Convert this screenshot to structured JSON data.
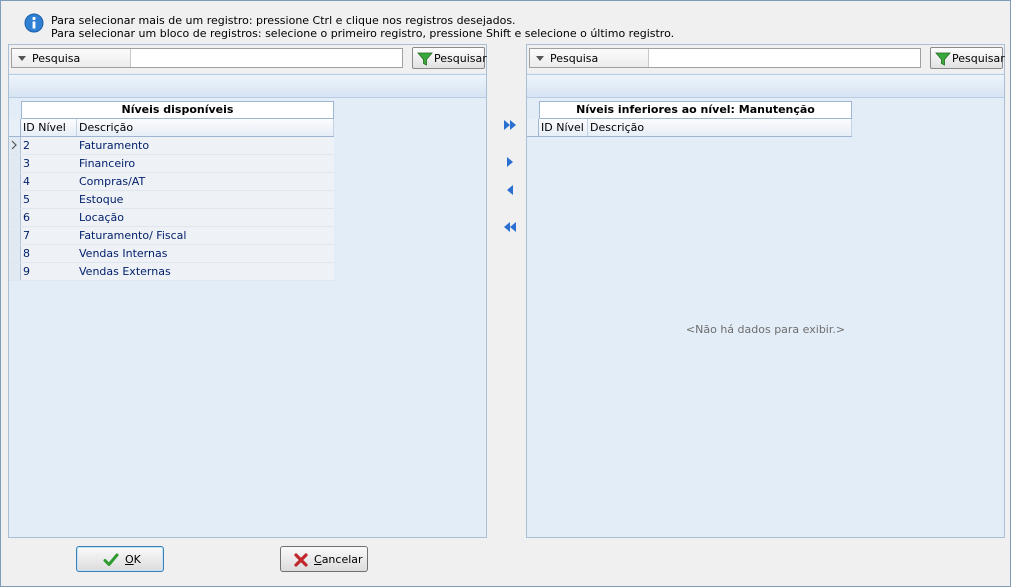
{
  "info": {
    "line1": "Para selecionar mais de um registro: pressione Ctrl e clique nos registros desejados.",
    "line2": "Para selecionar um bloco de registros: selecione o primeiro registro, pressione Shift e selecione o último registro."
  },
  "left": {
    "search_label": "Pesquisa",
    "search_value": "",
    "search_button": "Pesquisar",
    "band_title": "Níveis disponíveis",
    "col_id": "ID Nível",
    "col_desc": "Descrição",
    "rows": [
      {
        "id": "2",
        "desc": "Faturamento"
      },
      {
        "id": "3",
        "desc": "Financeiro"
      },
      {
        "id": "4",
        "desc": "Compras/AT"
      },
      {
        "id": "5",
        "desc": "Estoque"
      },
      {
        "id": "6",
        "desc": "Locação"
      },
      {
        "id": "7",
        "desc": "Faturamento/ Fiscal"
      },
      {
        "id": "8",
        "desc": "Vendas Internas"
      },
      {
        "id": "9",
        "desc": "Vendas Externas"
      }
    ]
  },
  "right": {
    "search_label": "Pesquisa",
    "search_value": "",
    "search_button": "Pesquisar",
    "band_title": "Níveis inferiores ao nível: Manutenção",
    "col_id": "ID Nível",
    "col_desc": "Descrição",
    "empty_text": "<Não há dados para exibir.>"
  },
  "buttons": {
    "ok_hotkey": "O",
    "ok_rest": "K",
    "cancel_hotkey": "C",
    "cancel_rest": "ancelar"
  },
  "colors": {
    "panel_bg": "#e3edf8",
    "arrow": "#2b6fd1",
    "ok_check": "#2e9b2e",
    "cancel_x": "#c0282c"
  }
}
